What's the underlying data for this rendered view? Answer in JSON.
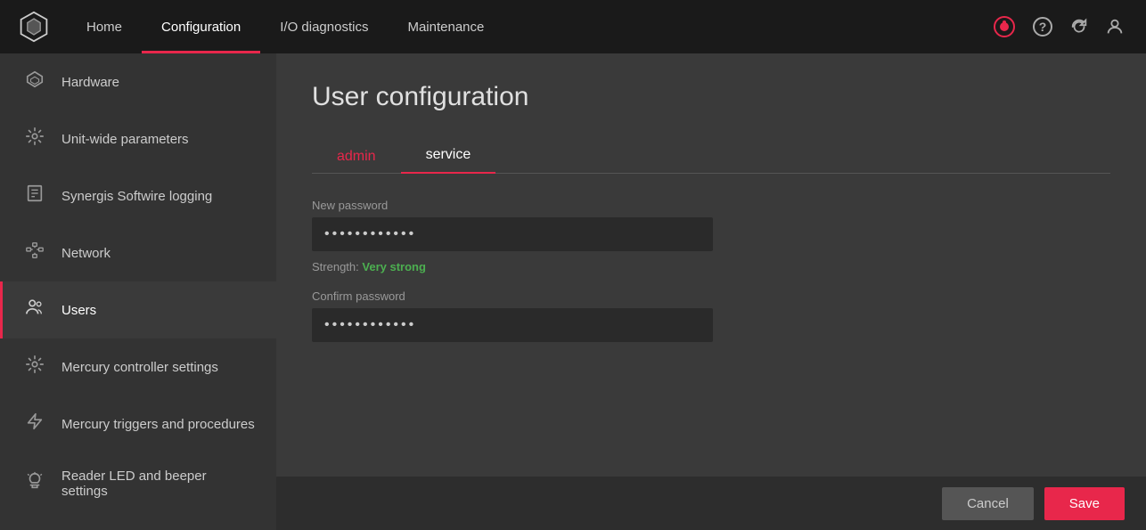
{
  "topnav": {
    "items": [
      {
        "id": "home",
        "label": "Home",
        "active": false
      },
      {
        "id": "configuration",
        "label": "Configuration",
        "active": true
      },
      {
        "id": "io-diagnostics",
        "label": "I/O diagnostics",
        "active": false
      },
      {
        "id": "maintenance",
        "label": "Maintenance",
        "active": false
      }
    ]
  },
  "sidebar": {
    "items": [
      {
        "id": "hardware",
        "label": "Hardware",
        "icon": "⬡",
        "active": false
      },
      {
        "id": "unit-wide-parameters",
        "label": "Unit-wide parameters",
        "icon": "⚙",
        "active": false
      },
      {
        "id": "synergis-softwire-logging",
        "label": "Synergis Softwire logging",
        "icon": "📄",
        "active": false
      },
      {
        "id": "network",
        "label": "Network",
        "icon": "⬛",
        "active": false
      },
      {
        "id": "users",
        "label": "Users",
        "icon": "👥",
        "active": true
      },
      {
        "id": "mercury-controller-settings",
        "label": "Mercury controller settings",
        "icon": "⚙",
        "active": false
      },
      {
        "id": "mercury-triggers-and-procedures",
        "label": "Mercury triggers and procedures",
        "icon": "📢",
        "active": false
      },
      {
        "id": "reader-led-and-beeper-settings",
        "label": "Reader LED and beeper settings",
        "icon": "🔔",
        "active": false
      }
    ]
  },
  "content": {
    "page_title": "User configuration",
    "tabs": [
      {
        "id": "admin",
        "label": "admin",
        "active": false
      },
      {
        "id": "service",
        "label": "service",
        "active": true
      }
    ],
    "form": {
      "new_password_label": "New password",
      "new_password_value": "············",
      "strength_label": "Strength:",
      "strength_value": "Very strong",
      "confirm_password_label": "Confirm password",
      "confirm_password_value": "············"
    }
  },
  "footer": {
    "cancel_label": "Cancel",
    "save_label": "Save"
  }
}
